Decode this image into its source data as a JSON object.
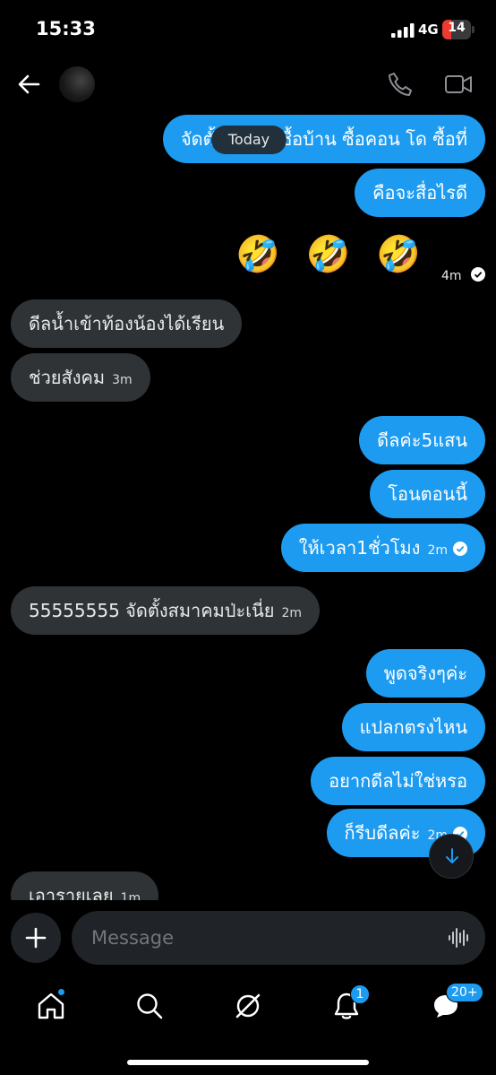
{
  "status": {
    "time": "15:33",
    "network": "4G",
    "battery": "14",
    "battery_level_pct": 14
  },
  "header": {
    "back_icon": "back-arrow-icon",
    "call_icon": "phone-icon",
    "video_icon": "video-icon"
  },
  "colors": {
    "outgoing_bubble": "#1d9bf0",
    "incoming_bubble": "#2f3336",
    "background": "#000000",
    "battery_low": "#eb3b30"
  },
  "chat": {
    "date_pill": "Today",
    "messages": [
      {
        "dir": "out",
        "text": "จัดตั้งสมาคมซื้อบ้าน ซื้อคอน โด ซื้อที่",
        "time": ""
      },
      {
        "dir": "out",
        "text": "คือจะสื่อไรดี",
        "time": ""
      },
      {
        "dir": "out",
        "text": "🤣 🤣 🤣",
        "time": "4m"
      },
      {
        "dir": "in",
        "text": "ดีลน้ำเข้าท้องน้องได้เรียน",
        "time": ""
      },
      {
        "dir": "in",
        "text": "ช่วยสังคม",
        "time": "3m"
      },
      {
        "dir": "out",
        "text": "ดีลค่ะ5แสน",
        "time": ""
      },
      {
        "dir": "out",
        "text": "โอนตอนนี้",
        "time": ""
      },
      {
        "dir": "out",
        "text": "ให้เวลา1ชั่วโมง",
        "time": "2m"
      },
      {
        "dir": "in",
        "text": "55555555 จัดตั้งสมาคมป่ะเนี่ย",
        "time": "2m"
      },
      {
        "dir": "out",
        "text": "พูดจริงๆค่ะ",
        "time": ""
      },
      {
        "dir": "out",
        "text": "แปลกตรงไหน",
        "time": ""
      },
      {
        "dir": "out",
        "text": "อยากดีลไม่ใช่หรอ",
        "time": ""
      },
      {
        "dir": "out",
        "text": "ก็รีบดีลค่ะ",
        "time": "2m"
      },
      {
        "dir": "in",
        "text": "เอารายเลย",
        "time": "1m"
      }
    ]
  },
  "composer": {
    "placeholder": "Message"
  },
  "tabbar": {
    "notifications_count": "1",
    "messages_count": "20+"
  }
}
